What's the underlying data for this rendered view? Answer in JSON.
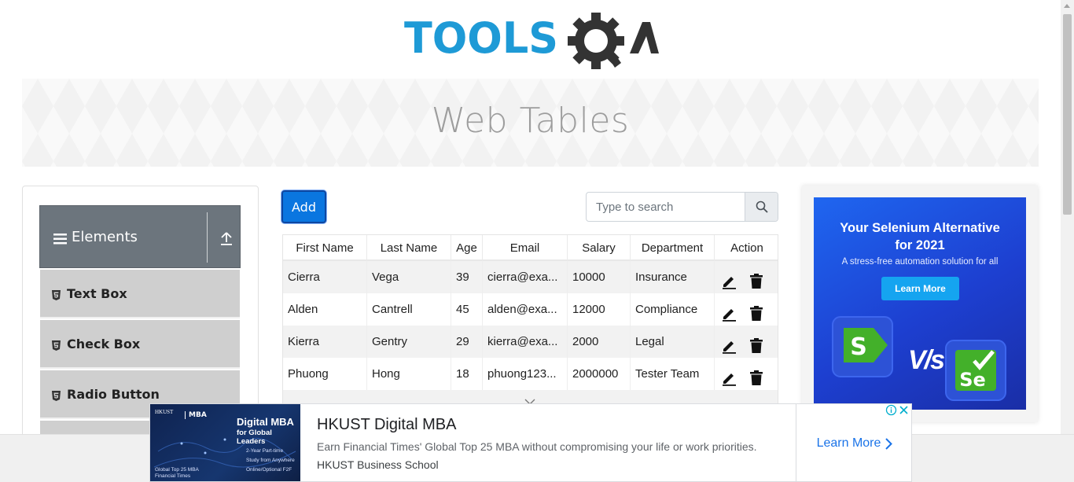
{
  "logo": {
    "text_left": "TOOLS",
    "text_right": "QA",
    "colors": {
      "blue": "#1e9ad6",
      "dark": "#333333"
    }
  },
  "banner": {
    "title": "Web Tables"
  },
  "sidebar": {
    "group_title": "Elements",
    "items": [
      {
        "label": "Text Box"
      },
      {
        "label": "Check Box"
      },
      {
        "label": "Radio Button"
      }
    ]
  },
  "toolbar": {
    "add_label": "Add",
    "search_placeholder": "Type to search",
    "search_value": ""
  },
  "table": {
    "headers": [
      "First Name",
      "Last Name",
      "Age",
      "Email",
      "Salary",
      "Department",
      "Action"
    ],
    "rows": [
      {
        "first": "Cierra",
        "last": "Vega",
        "age": "39",
        "email": "cierra@exa...",
        "salary": "10000",
        "department": "Insurance"
      },
      {
        "first": "Alden",
        "last": "Cantrell",
        "age": "45",
        "email": "alden@exa...",
        "salary": "12000",
        "department": "Compliance"
      },
      {
        "first": "Kierra",
        "last": "Gentry",
        "age": "29",
        "email": "kierra@exa...",
        "salary": "2000",
        "department": "Legal"
      },
      {
        "first": "Phuong",
        "last": "Hong",
        "age": "18",
        "email": "phuong123...",
        "salary": "2000000",
        "department": "Tester Team"
      }
    ]
  },
  "right_ad": {
    "title_line1": "Your Selenium Alternative",
    "title_line2": "for 2021",
    "subtitle": "A stress-free automation solution for all",
    "button": "Learn More",
    "vs": "V/s",
    "logo_left": "S",
    "logo_right": "Se",
    "colors": {
      "bg": "#1f4fe0",
      "button": "#15a4f0",
      "green": "#43b02a"
    }
  },
  "bottom_ad": {
    "thumb_tag": "MBA",
    "thumb_crest": "HKUST",
    "thumb_title_1": "Digital MBA",
    "thumb_title_2": "for Global Leaders",
    "thumb_points": [
      "2-Year Part-time",
      "Study from Anywhere",
      "Online/Optional F2F"
    ],
    "thumb_footer_1": "Global Top 25 MBA",
    "thumb_footer_2": "Financial Times",
    "headline": "HKUST Digital MBA",
    "description": "Earn Financial Times' Global Top 25 MBA without compromising your life or work priorities.",
    "source": "HKUST Business School",
    "cta": "Learn More"
  }
}
